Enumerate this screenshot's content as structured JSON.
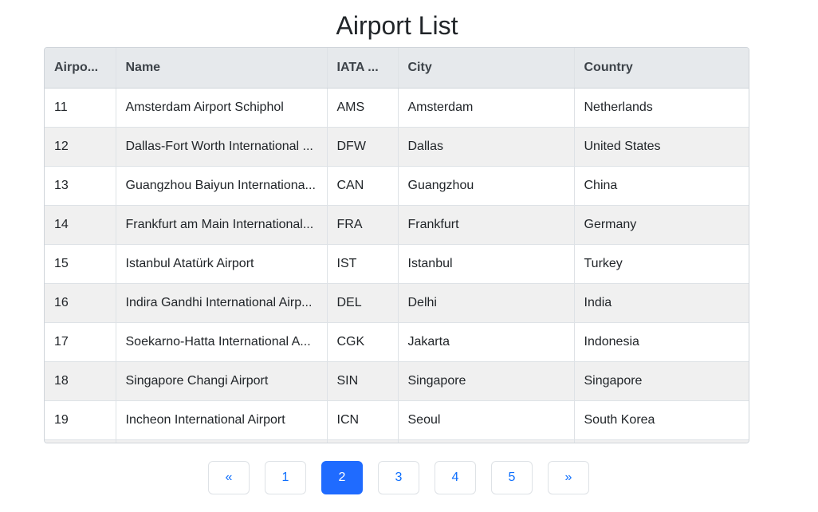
{
  "title": "Airport List",
  "table": {
    "headers": [
      "Airpo...",
      "Name",
      "IATA ...",
      "City",
      "Country"
    ],
    "rows": [
      [
        "11",
        "Amsterdam Airport Schiphol",
        "AMS",
        "Amsterdam",
        "Netherlands"
      ],
      [
        "12",
        "Dallas-Fort Worth International ...",
        "DFW",
        "Dallas",
        "United States"
      ],
      [
        "13",
        "Guangzhou Baiyun Internationa...",
        "CAN",
        "Guangzhou",
        "China"
      ],
      [
        "14",
        "Frankfurt am Main International...",
        "FRA",
        "Frankfurt",
        "Germany"
      ],
      [
        "15",
        "Istanbul Atatürk Airport",
        "IST",
        "Istanbul",
        "Turkey"
      ],
      [
        "16",
        "Indira Gandhi International Airp...",
        "DEL",
        "Delhi",
        "India"
      ],
      [
        "17",
        "Soekarno-Hatta International A...",
        "CGK",
        "Jakarta",
        "Indonesia"
      ],
      [
        "18",
        "Singapore Changi Airport",
        "SIN",
        "Singapore",
        "Singapore"
      ],
      [
        "19",
        "Incheon International Airport",
        "ICN",
        "Seoul",
        "South Korea"
      ]
    ]
  },
  "pagination": {
    "prev": "«",
    "pages": [
      "1",
      "2",
      "3",
      "4",
      "5"
    ],
    "active_page": "2",
    "next": "»"
  },
  "colors": {
    "accent": "#1f6bff",
    "link": "#0d6efd",
    "header_bg": "#e6e9ec",
    "stripe_bg": "#f0f0f0"
  }
}
